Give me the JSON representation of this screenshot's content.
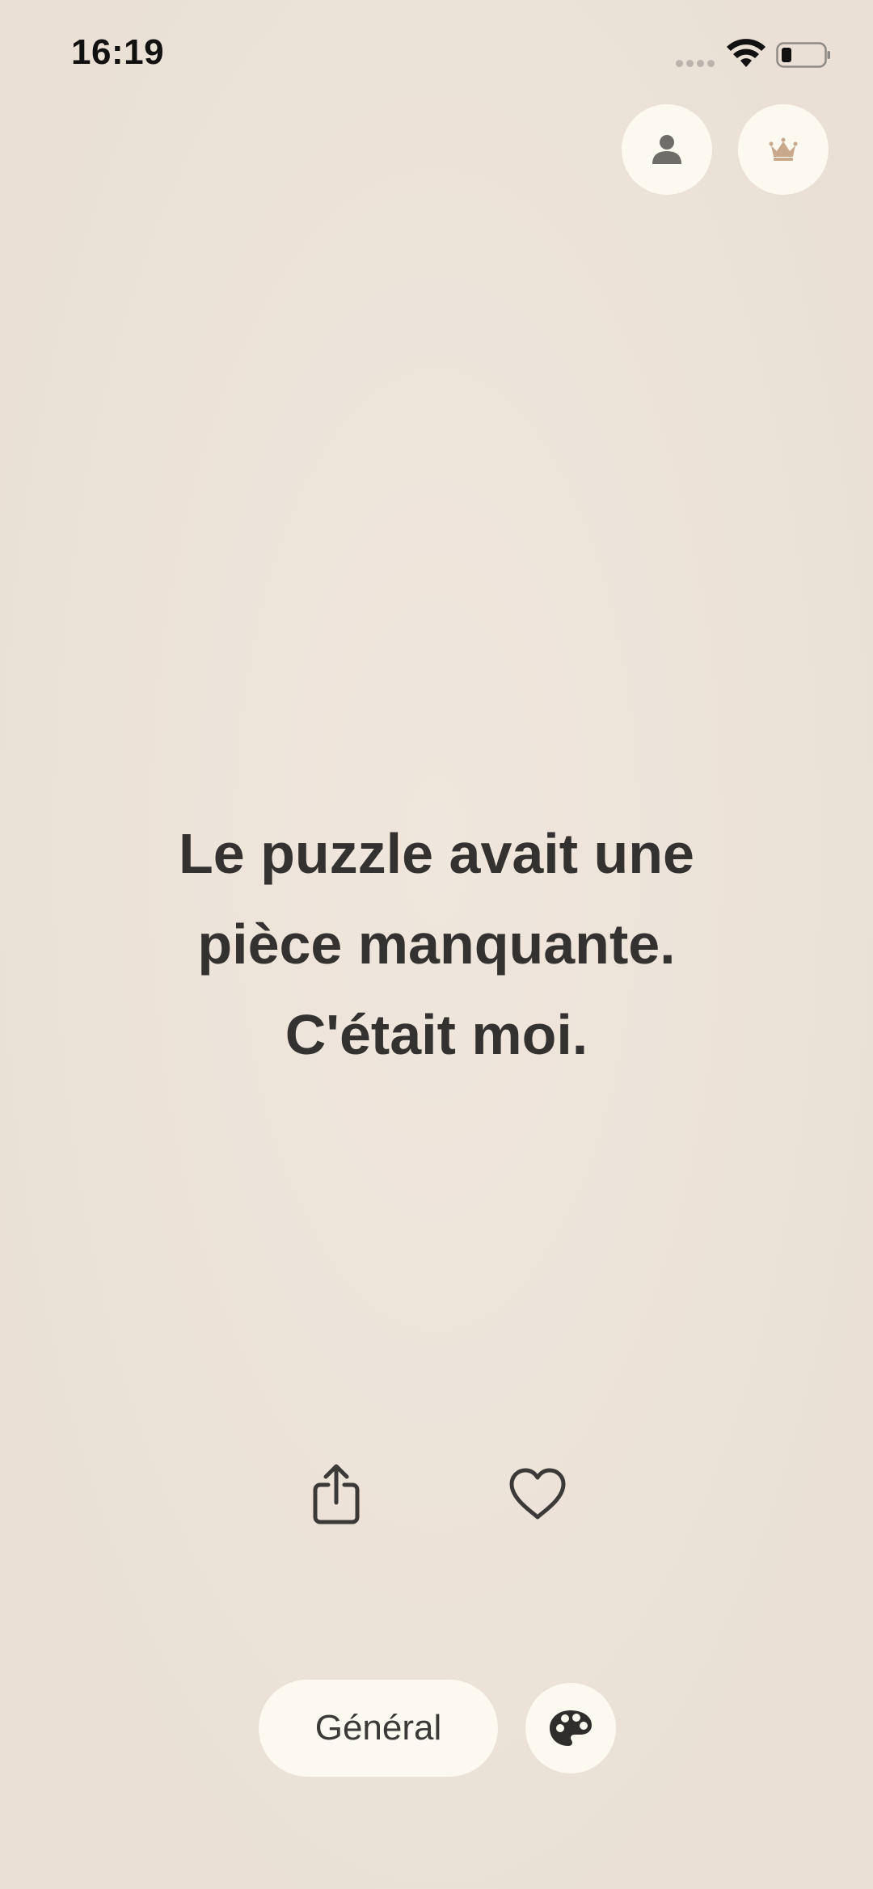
{
  "status_bar": {
    "time": "16:19"
  },
  "top_actions": {
    "profile_icon": "person-icon",
    "premium_icon": "crown-icon"
  },
  "quote": {
    "line1": "Le puzzle avait une",
    "line2": "pièce manquante.",
    "line3": "C'était moi."
  },
  "actions": {
    "share_icon": "share-icon",
    "like_icon": "heart-icon"
  },
  "bottom": {
    "category_label": "Général",
    "theme_icon": "palette-icon"
  },
  "colors": {
    "background": "#ebe2d8",
    "button_bg": "#fcf9f1",
    "text": "#333230",
    "crown_accent": "#c9a98c"
  }
}
